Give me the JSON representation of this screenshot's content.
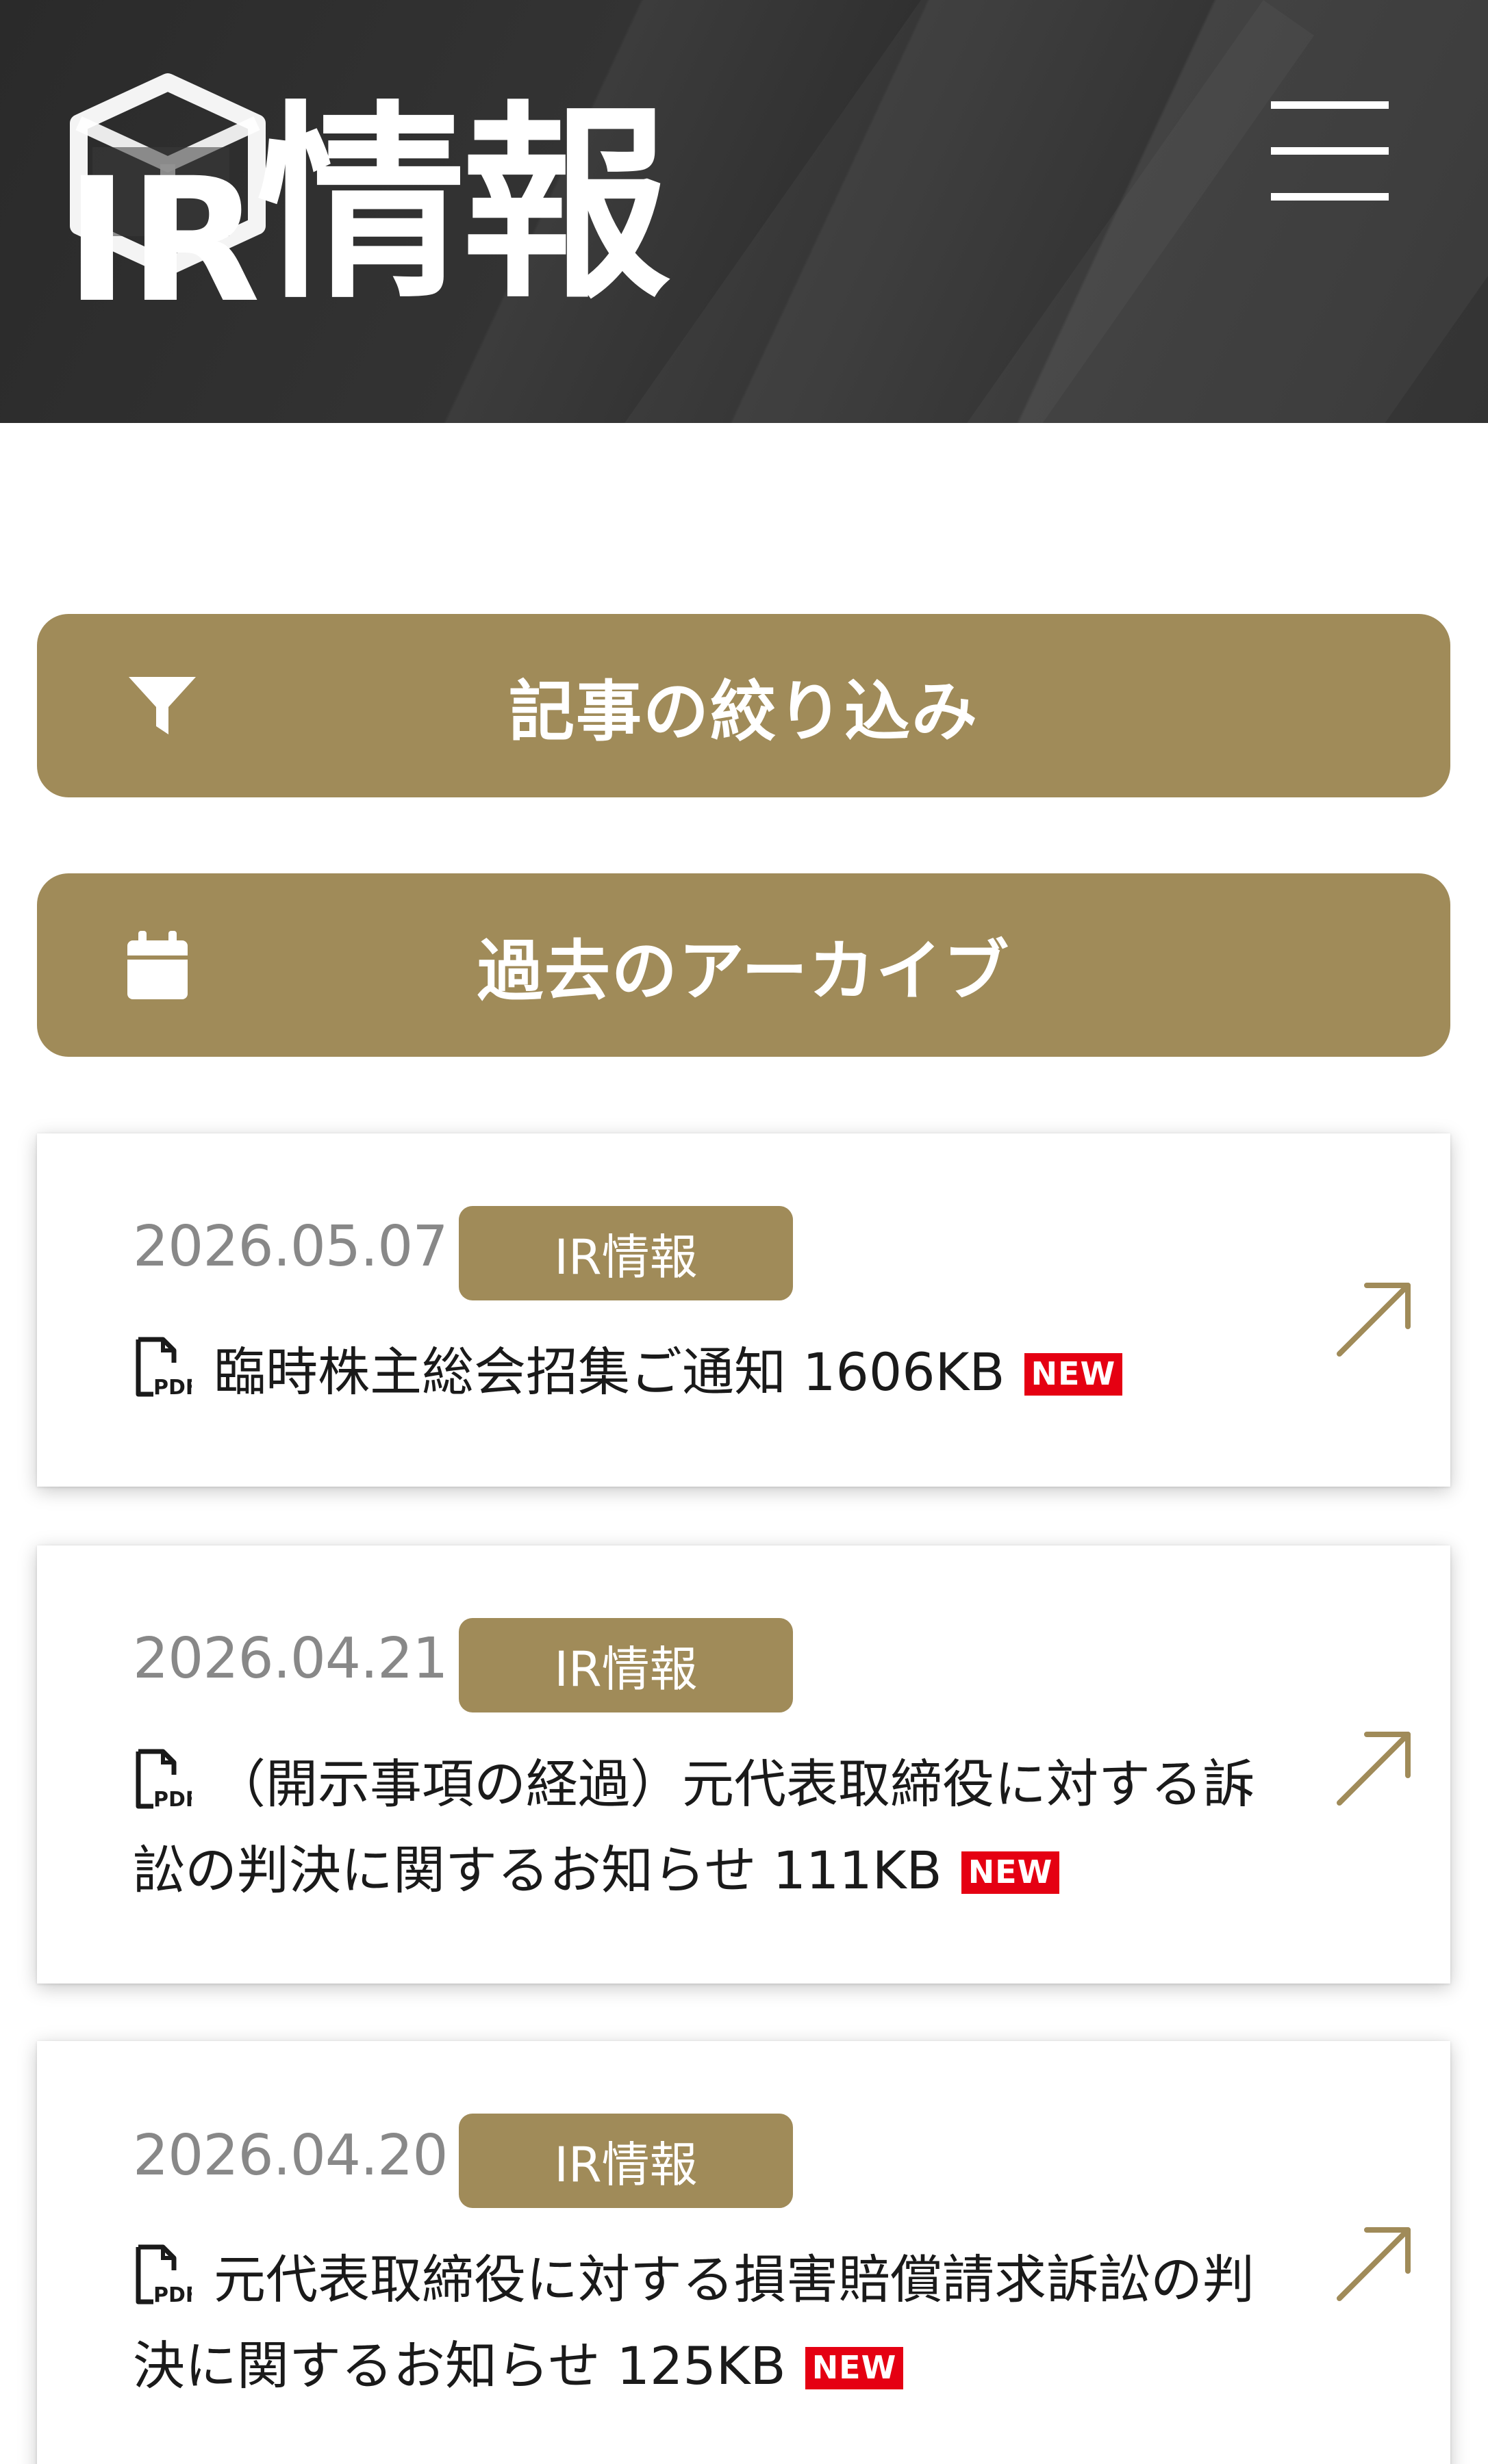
{
  "header": {
    "title": "情報",
    "logo_letters": "IR"
  },
  "filter_button": {
    "label": "記事の絞り込み",
    "icon": "filter-icon"
  },
  "archive_button": {
    "label": "過去のアーカイブ",
    "icon": "calendar-icon"
  },
  "articles": [
    {
      "date": "2026.05.07",
      "tag": "IR情報",
      "title": "臨時株主総会招集ご通知 1606KB",
      "badge": "NEW"
    },
    {
      "date": "2026.04.21",
      "tag": "IR情報",
      "title": "（開示事項の経過）元代表取締役に対する訴訟の判決に関するお知らせ 111KB",
      "badge": "NEW"
    },
    {
      "date": "2026.04.20",
      "tag": "IR情報",
      "title": "元代表取締役に対する損害賠償請求訴訟の判決に関するお知らせ 125KB",
      "badge": "NEW"
    }
  ],
  "colors": {
    "accent_gold": "#a08b59",
    "header_dark": "#333333",
    "new_badge_red": "#e50012",
    "date_gray": "#888888"
  }
}
